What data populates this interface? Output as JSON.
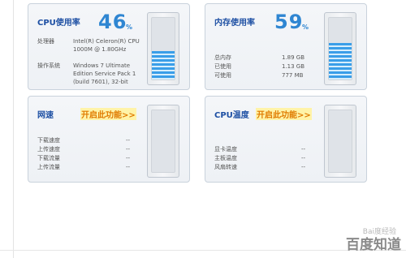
{
  "cpu": {
    "title": "CPU使用率",
    "percent_value": "46",
    "percent_sign": "%",
    "usage_fraction": 0.46,
    "processor_label": "处理器",
    "processor_value": "Intel(R) Celeron(R) CPU 1000M @ 1.80GHz",
    "os_label": "操作系统",
    "os_value": "Windows 7 Ultimate Edition Service Pack 1 (build 7601), 32-bit"
  },
  "memory": {
    "title": "内存使用率",
    "percent_value": "59",
    "percent_sign": "%",
    "usage_fraction": 0.59,
    "rows": [
      {
        "label": "总内存",
        "value": "1.89 GB"
      },
      {
        "label": "已使用",
        "value": "1.13 GB"
      },
      {
        "label": "可使用",
        "value": "777 MB"
      }
    ]
  },
  "network": {
    "title": "网速",
    "enable_link": "开启此功能>>",
    "rows": [
      {
        "label": "下载速度",
        "value": "--"
      },
      {
        "label": "上传速度",
        "value": "--"
      },
      {
        "label": "下载流量",
        "value": "--"
      },
      {
        "label": "上传流量",
        "value": "--"
      }
    ]
  },
  "temperature": {
    "title": "CPU温度",
    "enable_link": "开启此功能>>",
    "rows": [
      {
        "label": "显卡温度",
        "value": "--"
      },
      {
        "label": "主板温度",
        "value": "--"
      },
      {
        "label": "风扇转速",
        "value": "--"
      }
    ]
  },
  "watermark": {
    "brand": "百度知道",
    "faint": "Bai度经验"
  },
  "colors": {
    "accent_blue": "#2f86d2",
    "title_blue": "#1d4fa3",
    "link_orange": "#e07b00",
    "link_bg": "#fff3a8",
    "meter_fill": "#3a9ee8"
  }
}
